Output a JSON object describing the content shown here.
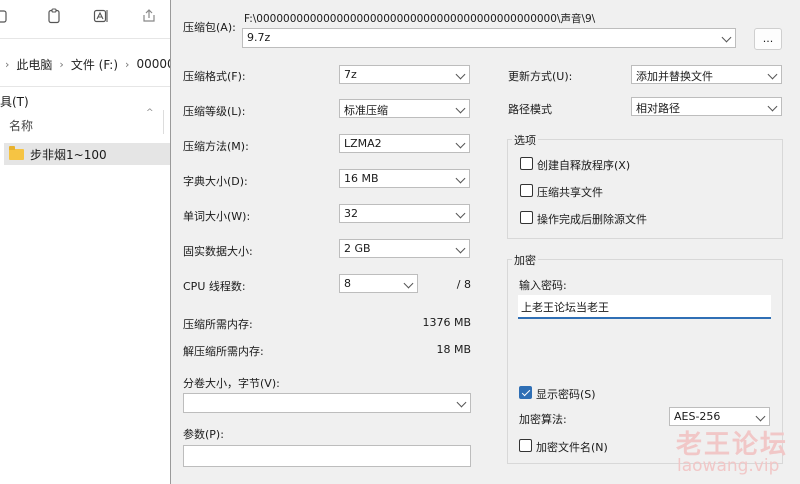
{
  "explorer": {
    "breadcrumb": [
      "此电脑",
      "文件 (F:)",
      "00000"
    ],
    "menu_tools": "具(T)",
    "column_name": "名称",
    "file_item": "步非烟1~100"
  },
  "dialog": {
    "archive_label": "压缩包(A):",
    "archive_path": "F:\\000000000000000000000000000000000000000000000\\声音\\9\\",
    "archive_name": "9.7z",
    "browse_label": "...",
    "left": {
      "format_label": "压缩格式(F):",
      "format_value": "7z",
      "level_label": "压缩等级(L):",
      "level_value": "标准压缩",
      "method_label": "压缩方法(M):",
      "method_value": "LZMA2",
      "dict_label": "字典大小(D):",
      "dict_value": "16 MB",
      "word_label": "单词大小(W):",
      "word_value": "32",
      "solid_label": "固实数据大小:",
      "solid_value": "2 GB",
      "threads_label": "CPU 线程数:",
      "threads_value": "8",
      "threads_max": "/ 8",
      "mem_compress_label": "压缩所需内存:",
      "mem_compress_value": "1376 MB",
      "mem_decompress_label": "解压缩所需内存:",
      "mem_decompress_value": "18 MB",
      "volume_label": "分卷大小，字节(V):",
      "volume_value": "",
      "params_label": "参数(P):",
      "params_value": ""
    },
    "right": {
      "update_label": "更新方式(U):",
      "update_value": "添加并替换文件",
      "path_label": "路径模式",
      "path_value": "相对路径",
      "options_title": "选项",
      "opt_sfx": "创建自释放程序(X)",
      "opt_shared": "压缩共享文件",
      "opt_delete": "操作完成后删除源文件",
      "encrypt_title": "加密",
      "password_label": "输入密码:",
      "password_value": "上老王论坛当老王",
      "show_password": "显示密码(S)",
      "encrypt_method_label": "加密算法:",
      "encrypt_method_value": "AES-256",
      "encrypt_names": "加密文件名(N)"
    }
  },
  "watermark": {
    "line1": "老王论坛",
    "line2": "laowang.vip"
  }
}
